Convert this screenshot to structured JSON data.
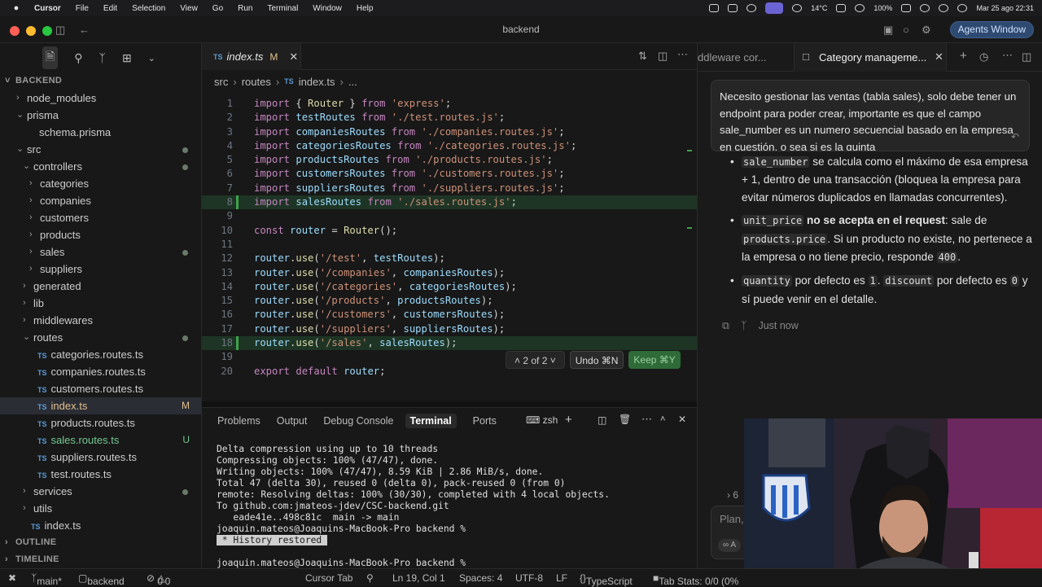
{
  "menubar": {
    "app": "Cursor",
    "items": [
      "File",
      "Edit",
      "Selection",
      "View",
      "Go",
      "Run",
      "Terminal",
      "Window",
      "Help"
    ],
    "weather": "14°C",
    "battery": "100%",
    "datetime": "Mar 25 ago  22:31"
  },
  "window": {
    "title": "backend",
    "agents_button": "Agents Window"
  },
  "explorer": {
    "root": "BACKEND",
    "tree": [
      {
        "label": "node_modules",
        "type": "folder",
        "depth": 0,
        "open": false
      },
      {
        "label": "prisma",
        "type": "folder",
        "depth": 0,
        "open": true
      },
      {
        "label": "schema.prisma",
        "type": "file",
        "depth": 1
      },
      {
        "label": "src",
        "type": "folder",
        "depth": 0,
        "open": true,
        "dot": true
      },
      {
        "label": "controllers",
        "type": "folder",
        "depth": 1,
        "open": true,
        "dot": true
      },
      {
        "label": "categories",
        "type": "folder",
        "depth": 2,
        "open": false
      },
      {
        "label": "companies",
        "type": "folder",
        "depth": 2,
        "open": false
      },
      {
        "label": "customers",
        "type": "folder",
        "depth": 2,
        "open": false
      },
      {
        "label": "products",
        "type": "folder",
        "depth": 2,
        "open": false
      },
      {
        "label": "sales",
        "type": "folder",
        "depth": 2,
        "open": false,
        "dot": true
      },
      {
        "label": "suppliers",
        "type": "folder",
        "depth": 2,
        "open": false
      },
      {
        "label": "generated",
        "type": "folder",
        "depth": 1,
        "open": false
      },
      {
        "label": "lib",
        "type": "folder",
        "depth": 1,
        "open": false
      },
      {
        "label": "middlewares",
        "type": "folder",
        "depth": 1,
        "open": false
      },
      {
        "label": "routes",
        "type": "folder",
        "depth": 1,
        "open": true,
        "dot": true
      },
      {
        "label": "categories.routes.ts",
        "type": "ts",
        "depth": 2
      },
      {
        "label": "companies.routes.ts",
        "type": "ts",
        "depth": 2
      },
      {
        "label": "customers.routes.ts",
        "type": "ts",
        "depth": 2
      },
      {
        "label": "index.ts",
        "type": "ts",
        "depth": 2,
        "badge": "M",
        "selected": true
      },
      {
        "label": "products.routes.ts",
        "type": "ts",
        "depth": 2
      },
      {
        "label": "sales.routes.ts",
        "type": "ts",
        "depth": 2,
        "badge": "U"
      },
      {
        "label": "suppliers.routes.ts",
        "type": "ts",
        "depth": 2
      },
      {
        "label": "test.routes.ts",
        "type": "ts",
        "depth": 2
      },
      {
        "label": "services",
        "type": "folder",
        "depth": 1,
        "open": false,
        "dot": true
      },
      {
        "label": "utils",
        "type": "folder",
        "depth": 1,
        "open": false
      },
      {
        "label": "index.ts",
        "type": "ts",
        "depth": 1
      }
    ],
    "outline": "OUTLINE",
    "timeline": "TIMELINE"
  },
  "editor": {
    "tab": {
      "lang": "TS",
      "name": "index.ts",
      "badge": "M"
    },
    "breadcrumbs": [
      "src",
      "routes",
      "index.ts",
      "..."
    ],
    "lines": [
      {
        "n": "1",
        "t": "import { Router } from 'express';"
      },
      {
        "n": "2",
        "t": "import testRoutes from './test.routes.js';"
      },
      {
        "n": "3",
        "t": "import companiesRoutes from './companies.routes.js';"
      },
      {
        "n": "4",
        "t": "import categoriesRoutes from './categories.routes.js';"
      },
      {
        "n": "5",
        "t": "import productsRoutes from './products.routes.js';"
      },
      {
        "n": "6",
        "t": "import customersRoutes from './customers.routes.js';"
      },
      {
        "n": "7",
        "t": "import suppliersRoutes from './suppliers.routes.js';"
      },
      {
        "n": "8",
        "t": "import salesRoutes from './sales.routes.js';",
        "added": true
      },
      {
        "n": "9",
        "t": ""
      },
      {
        "n": "10",
        "t": "const router = Router();"
      },
      {
        "n": "11",
        "t": ""
      },
      {
        "n": "12",
        "t": "router.use('/test', testRoutes);"
      },
      {
        "n": "13",
        "t": "router.use('/companies', companiesRoutes);"
      },
      {
        "n": "14",
        "t": "router.use('/categories', categoriesRoutes);"
      },
      {
        "n": "15",
        "t": "router.use('/products', productsRoutes);"
      },
      {
        "n": "16",
        "t": "router.use('/customers', customersRoutes);"
      },
      {
        "n": "17",
        "t": "router.use('/suppliers', suppliersRoutes);"
      },
      {
        "n": "18",
        "t": "router.use('/sales', salesRoutes);",
        "added": true
      },
      {
        "n": "19",
        "t": ""
      },
      {
        "n": "20",
        "t": "export default router;"
      }
    ],
    "diff": {
      "nav": "2 of 2",
      "undo": "Undo ⌘N",
      "keep": "Keep ⌘Y"
    }
  },
  "panel": {
    "tabs": [
      "Problems",
      "Output",
      "Debug Console",
      "Terminal",
      "Ports"
    ],
    "active_tab": "Terminal",
    "shell": "zsh",
    "terminal_lines": [
      "Delta compression using up to 10 threads",
      "Compressing objects: 100% (47/47), done.",
      "Writing objects: 100% (47/47), 8.59 KiB | 2.86 MiB/s, done.",
      "Total 47 (delta 30), reused 0 (delta 0), pack-reused 0 (from 0)",
      "remote: Resolving deltas: 100% (30/30), completed with 4 local objects.",
      "To github.com:jmateos-jdev/CSC-backend.git",
      "   eade41e..498c81c  main -> main",
      "joaquin.mateos@Joaquins-MacBook-Pro backend %"
    ],
    "restored": " * History restored ",
    "prompt": "joaquin.mateos@Joaquins-MacBook-Pro backend %"
  },
  "chat": {
    "tab_left": "ddleware cor...",
    "tab_active": "Category manageme...",
    "user_message": "Necesito gestionar las ventas (tabla sales), solo debe tener un endpoint para poder crear, importante es que el campo sale_number es un numero secuencial basado en la empresa en cuestión, o sea si es la quinta",
    "partial_top": "sale_number",
    "partial_rest": " se calcula como el máximo de esa empresa + 1, dentro de una transacción (bloquea la empresa para evitar números duplicados en llamadas concurrentes).",
    "b1_code": "unit_price",
    "b1_bold": " no se acepta en el request",
    "b1_mid": ": sale de ",
    "b1_code2": "products.price",
    "b1_rest": ". Si un producto no existe, no pertenece a la empresa o no tiene precio, responde ",
    "b1_code3": "400",
    "b1_end": ".",
    "b2_code": "quantity",
    "b2_mid": " por defecto es ",
    "b2_code2": "1",
    "b2_sep": ". ",
    "b2_code3": "discount",
    "b2_mid2": " por defecto es ",
    "b2_code4": "0",
    "b2_end": " y sí puede venir en el detalle.",
    "timestamp": "Just now",
    "input_placeholder": "Plan,",
    "collapsed_count": "6"
  },
  "statusbar": {
    "branch": "main*",
    "folder": "backend",
    "problems": "0",
    "warnings": "0",
    "cursor_tab": "Cursor Tab",
    "position": "Ln 19, Col 1",
    "spaces": "Spaces: 4",
    "encoding": "UTF-8",
    "eol": "LF",
    "language": "TypeScript",
    "tab_status": "Tab Stats: 0/0 (0%"
  }
}
